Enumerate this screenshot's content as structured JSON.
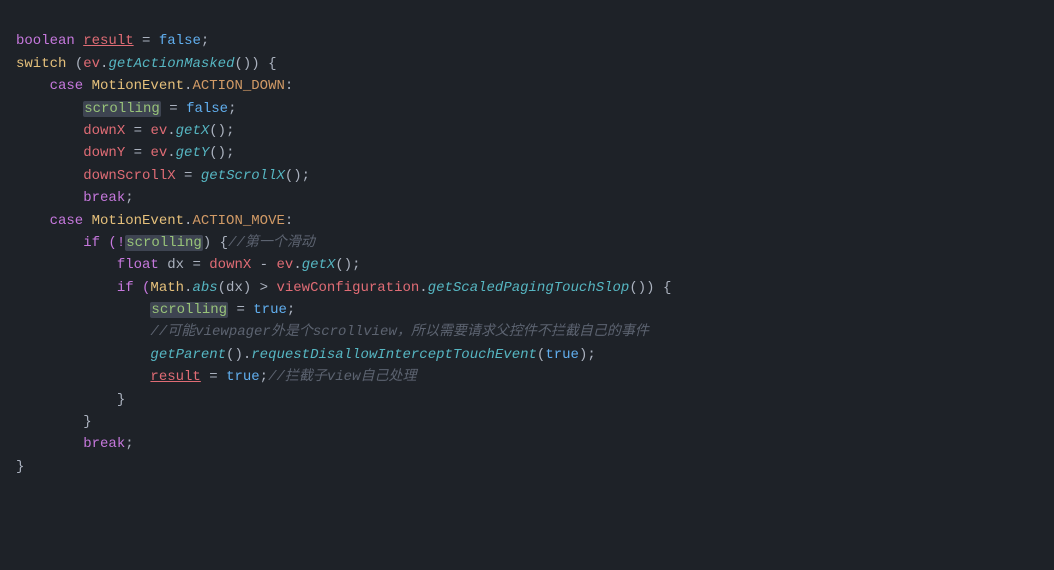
{
  "code": {
    "lines": [
      {
        "id": 1,
        "tokens": [
          {
            "t": "boolean",
            "c": "kw"
          },
          {
            "t": " ",
            "c": "plain"
          },
          {
            "t": "result",
            "c": "var underline"
          },
          {
            "t": " = ",
            "c": "plain"
          },
          {
            "t": "false",
            "c": "kw-blue"
          },
          {
            "t": ";",
            "c": "plain"
          }
        ]
      },
      {
        "id": 2,
        "tokens": [
          {
            "t": "switch",
            "c": "kw-switch"
          },
          {
            "t": " (",
            "c": "plain"
          },
          {
            "t": "ev",
            "c": "var"
          },
          {
            "t": ".",
            "c": "plain"
          },
          {
            "t": "getActionMasked",
            "c": "method-italic"
          },
          {
            "t": "()) {",
            "c": "plain"
          }
        ]
      },
      {
        "id": 3,
        "tokens": [
          {
            "t": "    case ",
            "c": "kw"
          },
          {
            "t": "MotionEvent",
            "c": "class-name"
          },
          {
            "t": ".",
            "c": "plain"
          },
          {
            "t": "ACTION_DOWN",
            "c": "const"
          },
          {
            "t": ":",
            "c": "plain"
          }
        ]
      },
      {
        "id": 4,
        "tokens": [
          {
            "t": "        ",
            "c": "plain"
          },
          {
            "t": "scrolling",
            "c": "scrolling-highlight"
          },
          {
            "t": " = ",
            "c": "plain"
          },
          {
            "t": "false",
            "c": "kw-blue"
          },
          {
            "t": ";",
            "c": "plain"
          }
        ]
      },
      {
        "id": 5,
        "tokens": [
          {
            "t": "        downX",
            "c": "var"
          },
          {
            "t": " = ",
            "c": "plain"
          },
          {
            "t": "ev",
            "c": "var"
          },
          {
            "t": ".",
            "c": "plain"
          },
          {
            "t": "getX",
            "c": "method-italic"
          },
          {
            "t": "();",
            "c": "plain"
          }
        ]
      },
      {
        "id": 6,
        "tokens": [
          {
            "t": "        downY",
            "c": "var"
          },
          {
            "t": " = ",
            "c": "plain"
          },
          {
            "t": "ev",
            "c": "var"
          },
          {
            "t": ".",
            "c": "plain"
          },
          {
            "t": "getY",
            "c": "method-italic"
          },
          {
            "t": "();",
            "c": "plain"
          }
        ]
      },
      {
        "id": 7,
        "tokens": [
          {
            "t": "        downScrollX",
            "c": "var"
          },
          {
            "t": " = ",
            "c": "plain"
          },
          {
            "t": "getScrollX",
            "c": "method-italic"
          },
          {
            "t": "();",
            "c": "plain"
          }
        ]
      },
      {
        "id": 8,
        "tokens": [
          {
            "t": "        ",
            "c": "plain"
          },
          {
            "t": "break",
            "c": "kw"
          },
          {
            "t": ";",
            "c": "plain"
          }
        ]
      },
      {
        "id": 9,
        "tokens": [
          {
            "t": "    case ",
            "c": "kw"
          },
          {
            "t": "MotionEvent",
            "c": "class-name"
          },
          {
            "t": ".",
            "c": "plain"
          },
          {
            "t": "ACTION_MOVE",
            "c": "const"
          },
          {
            "t": ":",
            "c": "plain"
          }
        ]
      },
      {
        "id": 10,
        "tokens": [
          {
            "t": "        if (!",
            "c": "kw"
          },
          {
            "t": "scrolling",
            "c": "scrolling-highlight"
          },
          {
            "t": ") {",
            "c": "plain"
          },
          {
            "t": "//第一个滑动",
            "c": "comment"
          }
        ]
      },
      {
        "id": 11,
        "tokens": [
          {
            "t": "            ",
            "c": "plain"
          },
          {
            "t": "float",
            "c": "kw"
          },
          {
            "t": " dx = ",
            "c": "plain"
          },
          {
            "t": "downX",
            "c": "var"
          },
          {
            "t": " - ",
            "c": "plain"
          },
          {
            "t": "ev",
            "c": "var"
          },
          {
            "t": ".",
            "c": "plain"
          },
          {
            "t": "getX",
            "c": "method-italic"
          },
          {
            "t": "();",
            "c": "plain"
          }
        ]
      },
      {
        "id": 12,
        "tokens": [
          {
            "t": "            if (",
            "c": "kw"
          },
          {
            "t": "Math",
            "c": "class-name"
          },
          {
            "t": ".",
            "c": "plain"
          },
          {
            "t": "abs",
            "c": "method-italic math-italic"
          },
          {
            "t": "(dx) > ",
            "c": "plain"
          },
          {
            "t": "viewConfiguration",
            "c": "var"
          },
          {
            "t": ".",
            "c": "plain"
          },
          {
            "t": "getScaledPagingTouchSlop",
            "c": "method-italic"
          },
          {
            "t": "()) {",
            "c": "plain"
          }
        ]
      },
      {
        "id": 13,
        "tokens": [
          {
            "t": "                ",
            "c": "plain"
          },
          {
            "t": "scrolling",
            "c": "scrolling-highlight"
          },
          {
            "t": " = ",
            "c": "plain"
          },
          {
            "t": "true",
            "c": "kw-blue"
          },
          {
            "t": ";",
            "c": "plain"
          }
        ]
      },
      {
        "id": 14,
        "tokens": [
          {
            "t": "                ",
            "c": "plain"
          },
          {
            "t": "//可能viewpager外是个scrollview，所以需要请求父控件不拦截自己的事件",
            "c": "comment"
          }
        ]
      },
      {
        "id": 15,
        "tokens": [
          {
            "t": "                ",
            "c": "plain"
          },
          {
            "t": "getParent",
            "c": "method-italic"
          },
          {
            "t": "().",
            "c": "plain"
          },
          {
            "t": "requestDisallowInterceptTouchEvent",
            "c": "method-italic"
          },
          {
            "t": "(",
            "c": "plain"
          },
          {
            "t": "true",
            "c": "kw-blue"
          },
          {
            "t": ");",
            "c": "plain"
          }
        ]
      },
      {
        "id": 16,
        "tokens": [
          {
            "t": "                ",
            "c": "plain"
          },
          {
            "t": "result",
            "c": "var underline"
          },
          {
            "t": " = ",
            "c": "plain"
          },
          {
            "t": "true",
            "c": "kw-blue"
          },
          {
            "t": ";",
            "c": "plain"
          },
          {
            "t": "//拦截子view自己处理",
            "c": "comment"
          }
        ]
      },
      {
        "id": 17,
        "tokens": [
          {
            "t": "            }",
            "c": "plain"
          }
        ]
      },
      {
        "id": 18,
        "tokens": [
          {
            "t": "        }",
            "c": "plain"
          }
        ]
      },
      {
        "id": 19,
        "tokens": [
          {
            "t": "        ",
            "c": "plain"
          },
          {
            "t": "break",
            "c": "kw"
          },
          {
            "t": ";",
            "c": "plain"
          }
        ]
      },
      {
        "id": 20,
        "tokens": [
          {
            "t": "}",
            "c": "plain"
          }
        ]
      },
      {
        "id": 21,
        "tokens": [
          {
            "t": "",
            "c": "plain"
          }
        ]
      }
    ]
  }
}
